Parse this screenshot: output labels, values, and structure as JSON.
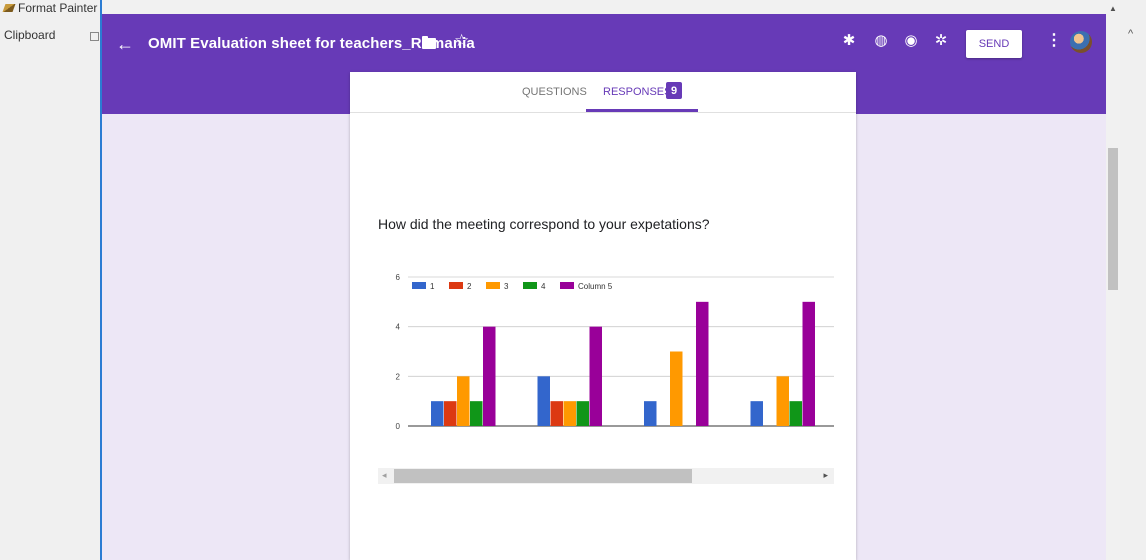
{
  "excel": {
    "format_painter_label": "Format Painter",
    "clipboard_label": "Clipboard",
    "collapse_glyph": "^"
  },
  "header": {
    "back_glyph": "←",
    "title": "OMIT Evaluation sheet for teachers_Romania",
    "star_glyph": "☆",
    "addons_glyph": "✱",
    "palette_glyph": "◍",
    "preview_glyph": "◉",
    "settings_glyph": "✲",
    "send_label": "SEND",
    "more_glyph": "⋮",
    "bg_color": "#673ab7"
  },
  "tabs": [
    {
      "label": "QUESTIONS"
    },
    {
      "label": "RESPONSES",
      "badge": "9",
      "active": true
    }
  ],
  "question": {
    "text": "How did the meeting correspond to your expetations?"
  },
  "chart_data": {
    "type": "bar",
    "categories": [
      "",
      "",
      "",
      ""
    ],
    "series": [
      {
        "name": "1",
        "values": [
          1,
          2,
          1,
          1
        ],
        "color": "#3366cc"
      },
      {
        "name": "2",
        "values": [
          1,
          1,
          0,
          0
        ],
        "color": "#dc3912"
      },
      {
        "name": "3",
        "values": [
          2,
          1,
          3,
          2
        ],
        "color": "#ff9900"
      },
      {
        "name": "4",
        "values": [
          1,
          1,
          0,
          1
        ],
        "color": "#109618"
      },
      {
        "name": "Column 5",
        "values": [
          4,
          4,
          5,
          5
        ],
        "color": "#990099"
      }
    ],
    "yticks": [
      0,
      2,
      4,
      6
    ],
    "ylim": [
      0,
      6
    ],
    "legend": "top-left",
    "grid": true
  },
  "scroll": {
    "left_glyph": "◂",
    "right_glyph": "▸",
    "up_glyph": "▲"
  }
}
